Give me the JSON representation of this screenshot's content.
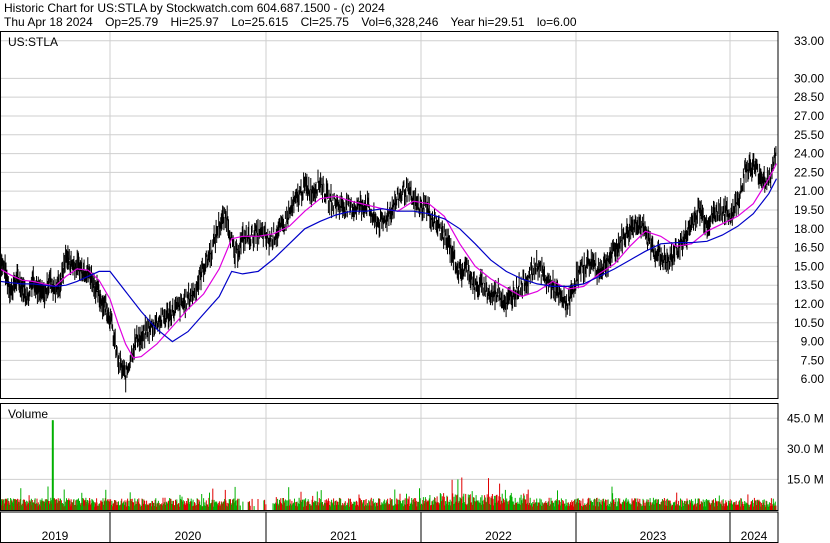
{
  "header": {
    "title": "Historic Chart for US:STLA by Stockwatch.com 604.687.1500 - (c) 2024",
    "stats": [
      "Thu Apr 18 2024",
      "Op=25.79",
      "Hi=25.97",
      "Lo=25.615",
      "Cl=25.75",
      "Vol=6,328,246",
      "Year hi=29.51",
      "lo=6.00"
    ]
  },
  "chart_data": {
    "type": "line",
    "symbol_label": "US:STLA",
    "x_categories": [
      "2019",
      "2020",
      "2021",
      "2022",
      "2023",
      "2024"
    ],
    "price_axis": {
      "ticks": [
        "33.00",
        "30.00",
        "28.50",
        "27.00",
        "25.50",
        "24.00",
        "22.50",
        "21.00",
        "19.50",
        "18.00",
        "16.50",
        "15.00",
        "13.50",
        "12.00",
        "10.50",
        "9.00",
        "7.50",
        "6.00"
      ],
      "ylim": [
        4.5,
        33.7
      ]
    },
    "volume_panel": {
      "label": "Volume",
      "ticks": [
        "45.0 M",
        "30.0 M",
        "15.0 M"
      ],
      "ylim": [
        0,
        52
      ]
    },
    "series": [
      {
        "role": "price",
        "color": "#000000",
        "t": [
          2019.0,
          2019.05,
          2019.1,
          2019.15,
          2019.2,
          2019.25,
          2019.3,
          2019.35,
          2019.4,
          2019.45,
          2019.5,
          2019.55,
          2019.6,
          2019.65,
          2019.7,
          2019.75,
          2019.8,
          2019.85,
          2019.9,
          2019.95,
          2020.0,
          2020.05,
          2020.1,
          2020.14,
          2020.18,
          2020.2,
          2020.23,
          2020.27,
          2020.3,
          2020.35,
          2020.4,
          2020.45,
          2020.5,
          2020.55,
          2020.6,
          2020.65,
          2020.7,
          2020.75,
          2020.8,
          2020.85,
          2020.9,
          2020.95,
          2020.98,
          2021.02,
          2021.05,
          2021.1,
          2021.15,
          2021.2,
          2021.25,
          2021.3,
          2021.35,
          2021.4,
          2021.45,
          2021.5,
          2021.55,
          2021.6,
          2021.65,
          2021.7,
          2021.75,
          2021.8,
          2021.85,
          2021.9,
          2021.95,
          2022.0,
          2022.03,
          2022.06,
          2022.1,
          2022.15,
          2022.2,
          2022.25,
          2022.3,
          2022.35,
          2022.4,
          2022.45,
          2022.5,
          2022.55,
          2022.6,
          2022.65,
          2022.7,
          2022.75,
          2022.8,
          2022.85,
          2022.9,
          2022.95,
          2023.0,
          2023.05,
          2023.1,
          2023.15,
          2023.2,
          2023.25,
          2023.3,
          2023.35,
          2023.4,
          2023.45,
          2023.5,
          2023.55,
          2023.6,
          2023.65,
          2023.7,
          2023.75,
          2023.8,
          2023.85,
          2023.9,
          2023.95,
          2024.0,
          2024.05,
          2024.1,
          2024.15,
          2024.2,
          2024.25,
          2024.3
        ],
        "values": [
          15.8,
          14.5,
          13.0,
          14.0,
          13.5,
          12.5,
          14.2,
          13.0,
          12.6,
          14.0,
          13.2,
          13.6,
          15.8,
          15.2,
          15.0,
          14.8,
          14.6,
          13.8,
          12.6,
          12.0,
          11.0,
          7.5,
          6.2,
          8.2,
          9.5,
          9.0,
          9.8,
          10.2,
          10.6,
          10.9,
          11.4,
          11.8,
          12.4,
          13.2,
          15.0,
          16.2,
          18.4,
          19.0,
          15.7,
          17.2,
          17.4,
          17.6,
          17.5,
          17.0,
          17.5,
          18.0,
          19.2,
          20.4,
          21.4,
          21.0,
          21.8,
          20.4,
          20.0,
          19.8,
          19.6,
          19.8,
          20.0,
          18.6,
          18.4,
          19.4,
          20.4,
          21.2,
          20.2,
          19.6,
          20.0,
          19.0,
          18.4,
          17.4,
          16.2,
          14.4,
          15.0,
          13.2,
          13.6,
          12.6,
          13.0,
          12.0,
          12.9,
          13.6,
          14.2,
          15.2,
          14.0,
          13.4,
          12.4,
          12.0,
          14.0,
          15.0,
          15.4,
          14.6,
          15.4,
          16.2,
          17.2,
          18.0,
          18.6,
          17.6,
          16.4,
          15.8,
          15.2,
          16.4,
          17.0,
          18.4,
          19.6,
          18.4,
          19.2,
          19.5,
          19.0,
          20.2,
          22.8,
          23.0,
          22.2,
          21.8,
          24.0
        ]
      },
      {
        "role": "short moving average",
        "color": "#e000e0",
        "t": [
          2019.0,
          2019.1,
          2019.2,
          2019.3,
          2019.4,
          2019.5,
          2019.6,
          2019.7,
          2019.8,
          2019.9,
          2020.0,
          2020.05,
          2020.1,
          2020.15,
          2020.2,
          2020.3,
          2020.4,
          2020.5,
          2020.6,
          2020.7,
          2020.78,
          2020.85,
          2020.95,
          2021.05,
          2021.15,
          2021.25,
          2021.35,
          2021.45,
          2021.55,
          2021.65,
          2021.75,
          2021.85,
          2021.95,
          2022.05,
          2022.15,
          2022.25,
          2022.35,
          2022.45,
          2022.55,
          2022.65,
          2022.75,
          2022.85,
          2022.95,
          2023.05,
          2023.15,
          2023.25,
          2023.35,
          2023.45,
          2023.55,
          2023.65,
          2023.75,
          2023.85,
          2023.95,
          2024.05,
          2024.15,
          2024.25,
          2024.3
        ],
        "values": [
          14.8,
          14.3,
          13.9,
          13.8,
          13.6,
          13.4,
          14.2,
          14.8,
          14.7,
          13.9,
          12.4,
          10.5,
          8.8,
          7.7,
          7.8,
          8.8,
          10.2,
          11.6,
          12.8,
          14.8,
          17.2,
          17.4,
          17.4,
          17.6,
          18.2,
          19.4,
          20.4,
          20.6,
          20.2,
          19.9,
          19.6,
          19.4,
          20.2,
          20.0,
          19.0,
          16.8,
          15.0,
          14.0,
          13.3,
          12.6,
          13.0,
          13.8,
          13.2,
          13.4,
          14.4,
          15.2,
          16.6,
          17.8,
          17.4,
          16.6,
          16.8,
          17.8,
          18.4,
          19.0,
          20.0,
          22.0,
          23.2
        ]
      },
      {
        "role": "long moving average",
        "color": "#0000c8",
        "t": [
          2019.0,
          2019.1,
          2019.2,
          2019.3,
          2019.4,
          2019.5,
          2019.6,
          2019.7,
          2019.8,
          2019.9,
          2020.0,
          2020.1,
          2020.2,
          2020.3,
          2020.4,
          2020.5,
          2020.6,
          2020.7,
          2020.78,
          2020.85,
          2020.95,
          2021.05,
          2021.15,
          2021.25,
          2021.35,
          2021.45,
          2021.55,
          2021.65,
          2021.75,
          2021.85,
          2021.95,
          2022.05,
          2022.15,
          2022.25,
          2022.35,
          2022.45,
          2022.55,
          2022.65,
          2022.75,
          2022.85,
          2022.95,
          2023.05,
          2023.15,
          2023.25,
          2023.35,
          2023.45,
          2023.55,
          2023.65,
          2023.75,
          2023.85,
          2023.95,
          2024.05,
          2024.15,
          2024.25,
          2024.3
        ],
        "values": [
          13.8,
          13.7,
          13.6,
          13.6,
          13.5,
          13.4,
          13.5,
          13.8,
          14.2,
          14.6,
          14.6,
          13.0,
          11.4,
          10.0,
          9.0,
          9.8,
          11.2,
          12.6,
          14.6,
          14.4,
          14.6,
          15.6,
          16.8,
          18.0,
          18.6,
          19.1,
          19.4,
          19.4,
          19.6,
          19.4,
          19.4,
          19.2,
          18.8,
          18.0,
          16.8,
          15.5,
          14.6,
          14.0,
          13.6,
          13.4,
          13.4,
          13.6,
          14.2,
          14.8,
          15.5,
          16.2,
          16.8,
          16.9,
          16.9,
          17.0,
          17.5,
          18.2,
          19.2,
          20.8,
          22.0
        ]
      }
    ],
    "volume": {
      "up_color": "#00b000",
      "down_color": "#e00000",
      "typical_m": 4.0,
      "spike": {
        "t": 2019.48,
        "value_m": 44.0
      }
    }
  }
}
